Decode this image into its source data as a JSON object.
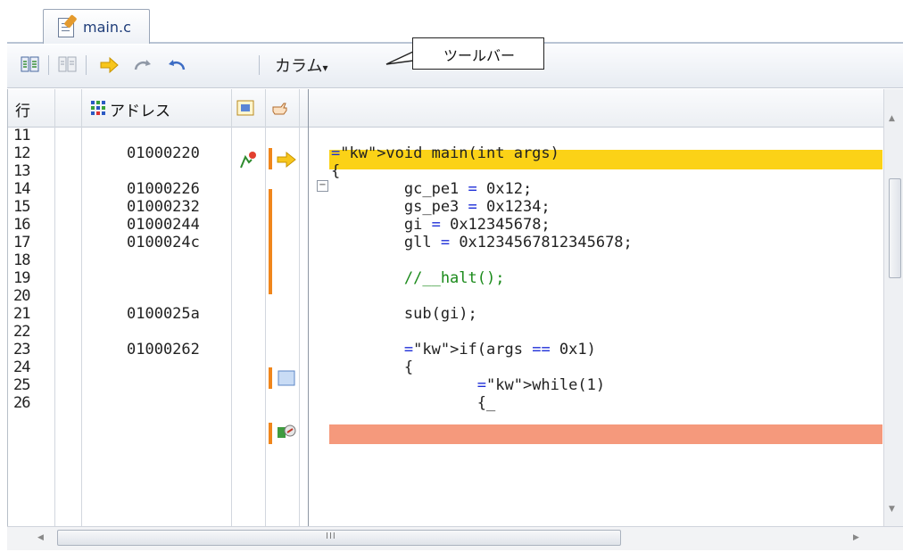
{
  "tab": {
    "label": "main.c",
    "icon": "document-edit-icon"
  },
  "toolbar": {
    "column_label": "カラム",
    "column_arrow": "▾",
    "callout": "ツールバー",
    "icons": [
      "source-view-icon",
      "disabled-source-view-icon",
      "go-to-pc-icon",
      "redo-icon",
      "undo-icon"
    ]
  },
  "columns": {
    "line": "行",
    "address": "アドレス",
    "address_icon": "address-grid-icon",
    "event_icon": "event-column-icon",
    "pc_icon": "pc-hand-icon"
  },
  "lines": [
    {
      "no": "11",
      "addr": "",
      "code": ""
    },
    {
      "no": "12",
      "addr": "01000220",
      "code": "void main(int args)"
    },
    {
      "no": "13",
      "addr": "",
      "code": "{"
    },
    {
      "no": "14",
      "addr": "01000226",
      "code": "        gc_pe1 = 0x12;"
    },
    {
      "no": "15",
      "addr": "01000232",
      "code": "        gs_pe3 = 0x1234;"
    },
    {
      "no": "16",
      "addr": "01000244",
      "code": "        gi = 0x12345678;"
    },
    {
      "no": "17",
      "addr": "0100024c",
      "code": "        gll = 0x1234567812345678;"
    },
    {
      "no": "18",
      "addr": "",
      "code": ""
    },
    {
      "no": "19",
      "addr": "",
      "code": "        //__halt();"
    },
    {
      "no": "20",
      "addr": "",
      "code": ""
    },
    {
      "no": "21",
      "addr": "0100025a",
      "code": "        sub(gi);"
    },
    {
      "no": "22",
      "addr": "",
      "code": ""
    },
    {
      "no": "23",
      "addr": "01000262",
      "code": "        if(args == 0x1)"
    },
    {
      "no": "24",
      "addr": "",
      "code": "        {"
    },
    {
      "no": "25",
      "addr": "",
      "code": "                while(1)"
    },
    {
      "no": "26",
      "addr": "",
      "code": "                {_"
    }
  ],
  "scrollbar_glyph": "III",
  "colors": {
    "current_line": "#fbd217",
    "breakpoint_line": "#f5997c",
    "coverage_bar": "#f0861c",
    "keyword": "#a2127b",
    "comment": "#1a8a1a",
    "operator": "#1c2dd8"
  }
}
